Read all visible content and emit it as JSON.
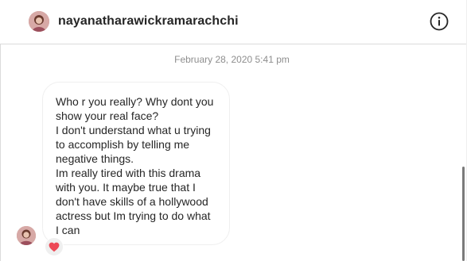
{
  "header": {
    "username": "nayanatharawickramarachchi",
    "avatar_icon": "profile-photo",
    "info_icon": "info-icon"
  },
  "thread": {
    "timestamp": "February 28, 2020 5:41 pm",
    "messages": [
      {
        "text": "Who r you really? Why dont you show your real face?\nI don't understand what u trying to accomplish by telling me negative things.\nIm really tired with this drama with you. It maybe true that I don't have skills of a hollywood actress but Im trying to do what I can",
        "reaction": "❤️",
        "reaction_icon": "heart-icon"
      }
    ]
  },
  "colors": {
    "text": "#262626",
    "muted": "#8e8e8e",
    "border": "#dbdbdb",
    "heart": "#ed4956"
  }
}
